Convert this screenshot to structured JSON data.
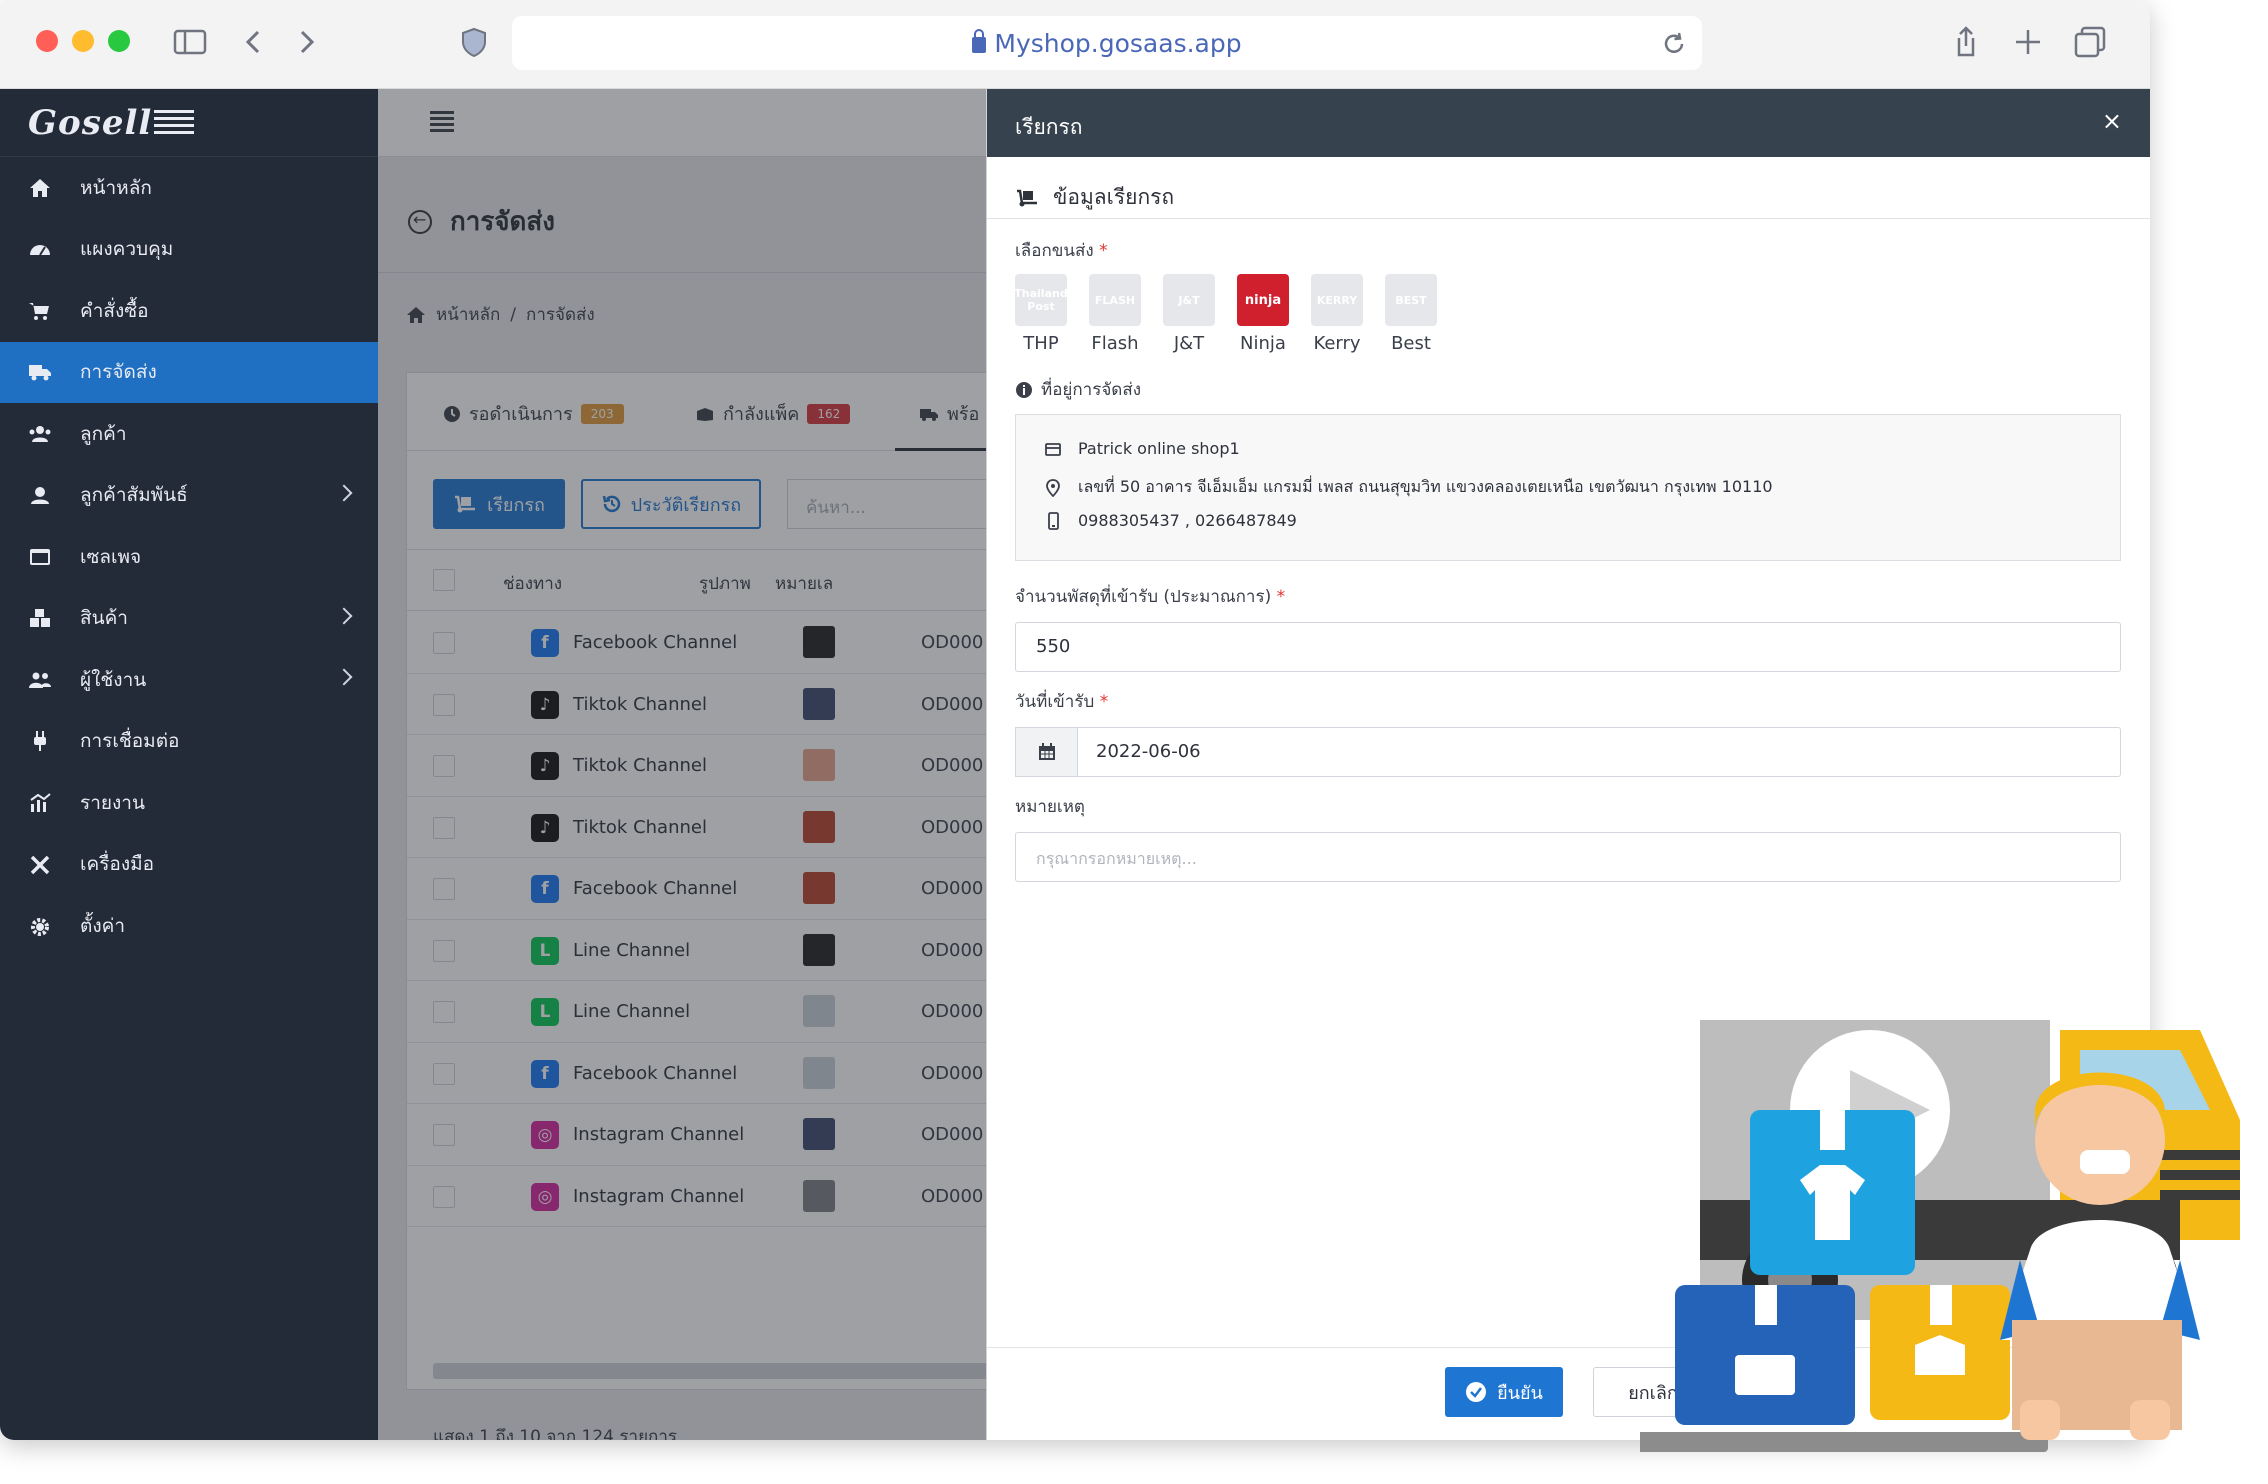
{
  "browser": {
    "url": "Myshop.gosaas.app"
  },
  "brand": {
    "name": "Gosell"
  },
  "sidebar": {
    "items": [
      {
        "label": "หน้าหลัก",
        "icon": "home-icon"
      },
      {
        "label": "แผงควบคุม",
        "icon": "dashboard-icon"
      },
      {
        "label": "คำสั่งซื้อ",
        "icon": "cart-icon"
      },
      {
        "label": "การจัดส่ง",
        "icon": "truck-icon",
        "active": true
      },
      {
        "label": "ลูกค้า",
        "icon": "users-icon"
      },
      {
        "label": "ลูกค้าสัมพันธ์",
        "icon": "crm-icon",
        "submenu": true
      },
      {
        "label": "เซลเพจ",
        "icon": "salespage-icon"
      },
      {
        "label": "สินค้า",
        "icon": "boxes-icon",
        "submenu": true
      },
      {
        "label": "ผู้ใช้งาน",
        "icon": "user-group-icon",
        "submenu": true
      },
      {
        "label": "การเชื่อมต่อ",
        "icon": "plug-icon"
      },
      {
        "label": "รายงาน",
        "icon": "report-icon"
      },
      {
        "label": "เครื่องมือ",
        "icon": "tools-icon"
      },
      {
        "label": "ตั้งค่า",
        "icon": "gear-icon"
      }
    ]
  },
  "main": {
    "title": "การจัดส่ง",
    "breadcrumb": {
      "home": "หน้าหลัก",
      "sep": "/",
      "current": "การจัดส่ง"
    },
    "tabs": [
      {
        "label": "รอดำเนินการ",
        "count": "203",
        "color": "#e09a3a"
      },
      {
        "label": "กำลังแพ็ค",
        "count": "162",
        "color": "#d9363e"
      },
      {
        "label": "พร้อ"
      }
    ],
    "buttons": {
      "call_pickup": "เรียกรถ",
      "pickup_history": "ประวัติเรียกรถ"
    },
    "search_placeholder": "ค้นหา...",
    "columns": {
      "channel": "ช่องทาง",
      "image": "รูปภาพ",
      "order_no": "หมายเล"
    },
    "rows": [
      {
        "channel": "Facebook Channel",
        "type": "facebook",
        "order": "OD000"
      },
      {
        "channel": "Tiktok Channel",
        "type": "tiktok",
        "order": "OD000"
      },
      {
        "channel": "Tiktok Channel",
        "type": "tiktok",
        "order": "OD000"
      },
      {
        "channel": "Tiktok Channel",
        "type": "tiktok",
        "order": "OD000"
      },
      {
        "channel": "Facebook Channel",
        "type": "facebook",
        "order": "OD000"
      },
      {
        "channel": "Line Channel",
        "type": "line",
        "order": "OD000"
      },
      {
        "channel": "Line Channel",
        "type": "line",
        "order": "OD000"
      },
      {
        "channel": "Facebook Channel",
        "type": "facebook",
        "order": "OD000"
      },
      {
        "channel": "Instagram Channel",
        "type": "instagram",
        "order": "OD000"
      },
      {
        "channel": "Instagram Channel",
        "type": "instagram",
        "order": "OD000"
      }
    ],
    "footer": "แสดง 1 ถึง 10 จาก 124 รายการ"
  },
  "drawer": {
    "title": "เรียกรถ",
    "section": "ข้อมูลเรียกรถ",
    "carrier_label": "เลือกขนส่ง",
    "carriers": [
      {
        "name": "THP",
        "logo": "Thailand Post"
      },
      {
        "name": "Flash",
        "logo": "FLASH"
      },
      {
        "name": "J&T",
        "logo": "J&T"
      },
      {
        "name": "Ninja",
        "logo": "ninja",
        "selected": true
      },
      {
        "name": "Kerry",
        "logo": "KERRY"
      },
      {
        "name": "Best",
        "logo": "BEST"
      }
    ],
    "address_label": "ที่อยู่การจัดส่ง",
    "address": {
      "shop": "Patrick online shop1",
      "line": "เลขที่ 50 อาคาร จีเอ็มเอ็ม แกรมมี่ เพลส ถนนสุขุมวิท แขวงคลองเตยเหนือ เขตวัฒนา กรุงเทพ 10110",
      "phone": "0988305437 , 0266487849"
    },
    "parcel_label": "จำนวนพัสดุที่เข้ารับ (ประมาณการ)",
    "parcel_value": "550",
    "date_label": "วันที่เข้ารับ",
    "date_value": "2022-06-06",
    "note_label": "หมายเหตุ",
    "note_placeholder": "กรุณากรอกหมายเหตุ...",
    "confirm": "ยืนยัน",
    "cancel": "ยกเลิก"
  },
  "colors": {
    "accent": "#1f76d2",
    "sidebar": "#232a38",
    "active": "#1f6fc2",
    "drawer_header": "#36424d"
  }
}
